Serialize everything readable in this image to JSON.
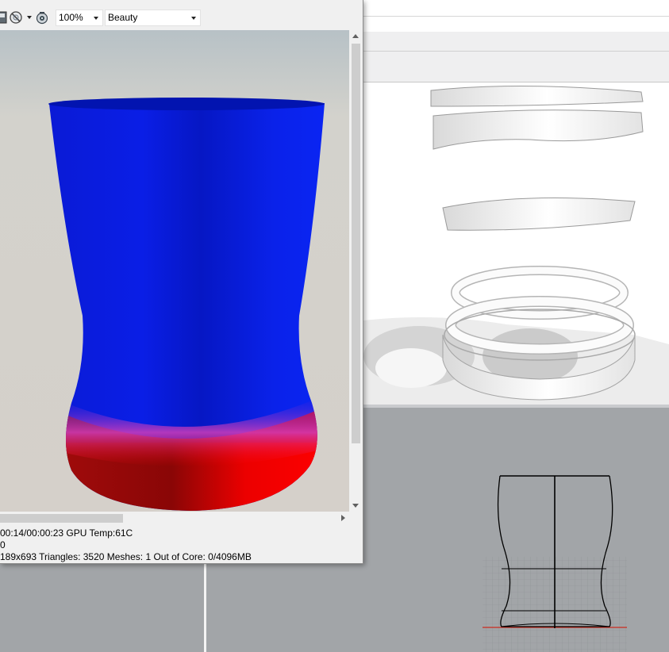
{
  "render_window": {
    "toolbar": {
      "zoom_value": "100%",
      "channel_value": "Beauty"
    },
    "status": {
      "line1": "00:14/00:00:23  GPU Temp:61C",
      "line2": "0",
      "line3": "189x693  Triangles: 3520  Meshes: 1 Out of Core: 0/4096MB"
    }
  },
  "colors": {
    "vase_blue": "#0a1ee6",
    "vase_red": "#ff0000",
    "viewport_gray": "#a2a5a8",
    "axis_red": "#cc2a1e"
  }
}
